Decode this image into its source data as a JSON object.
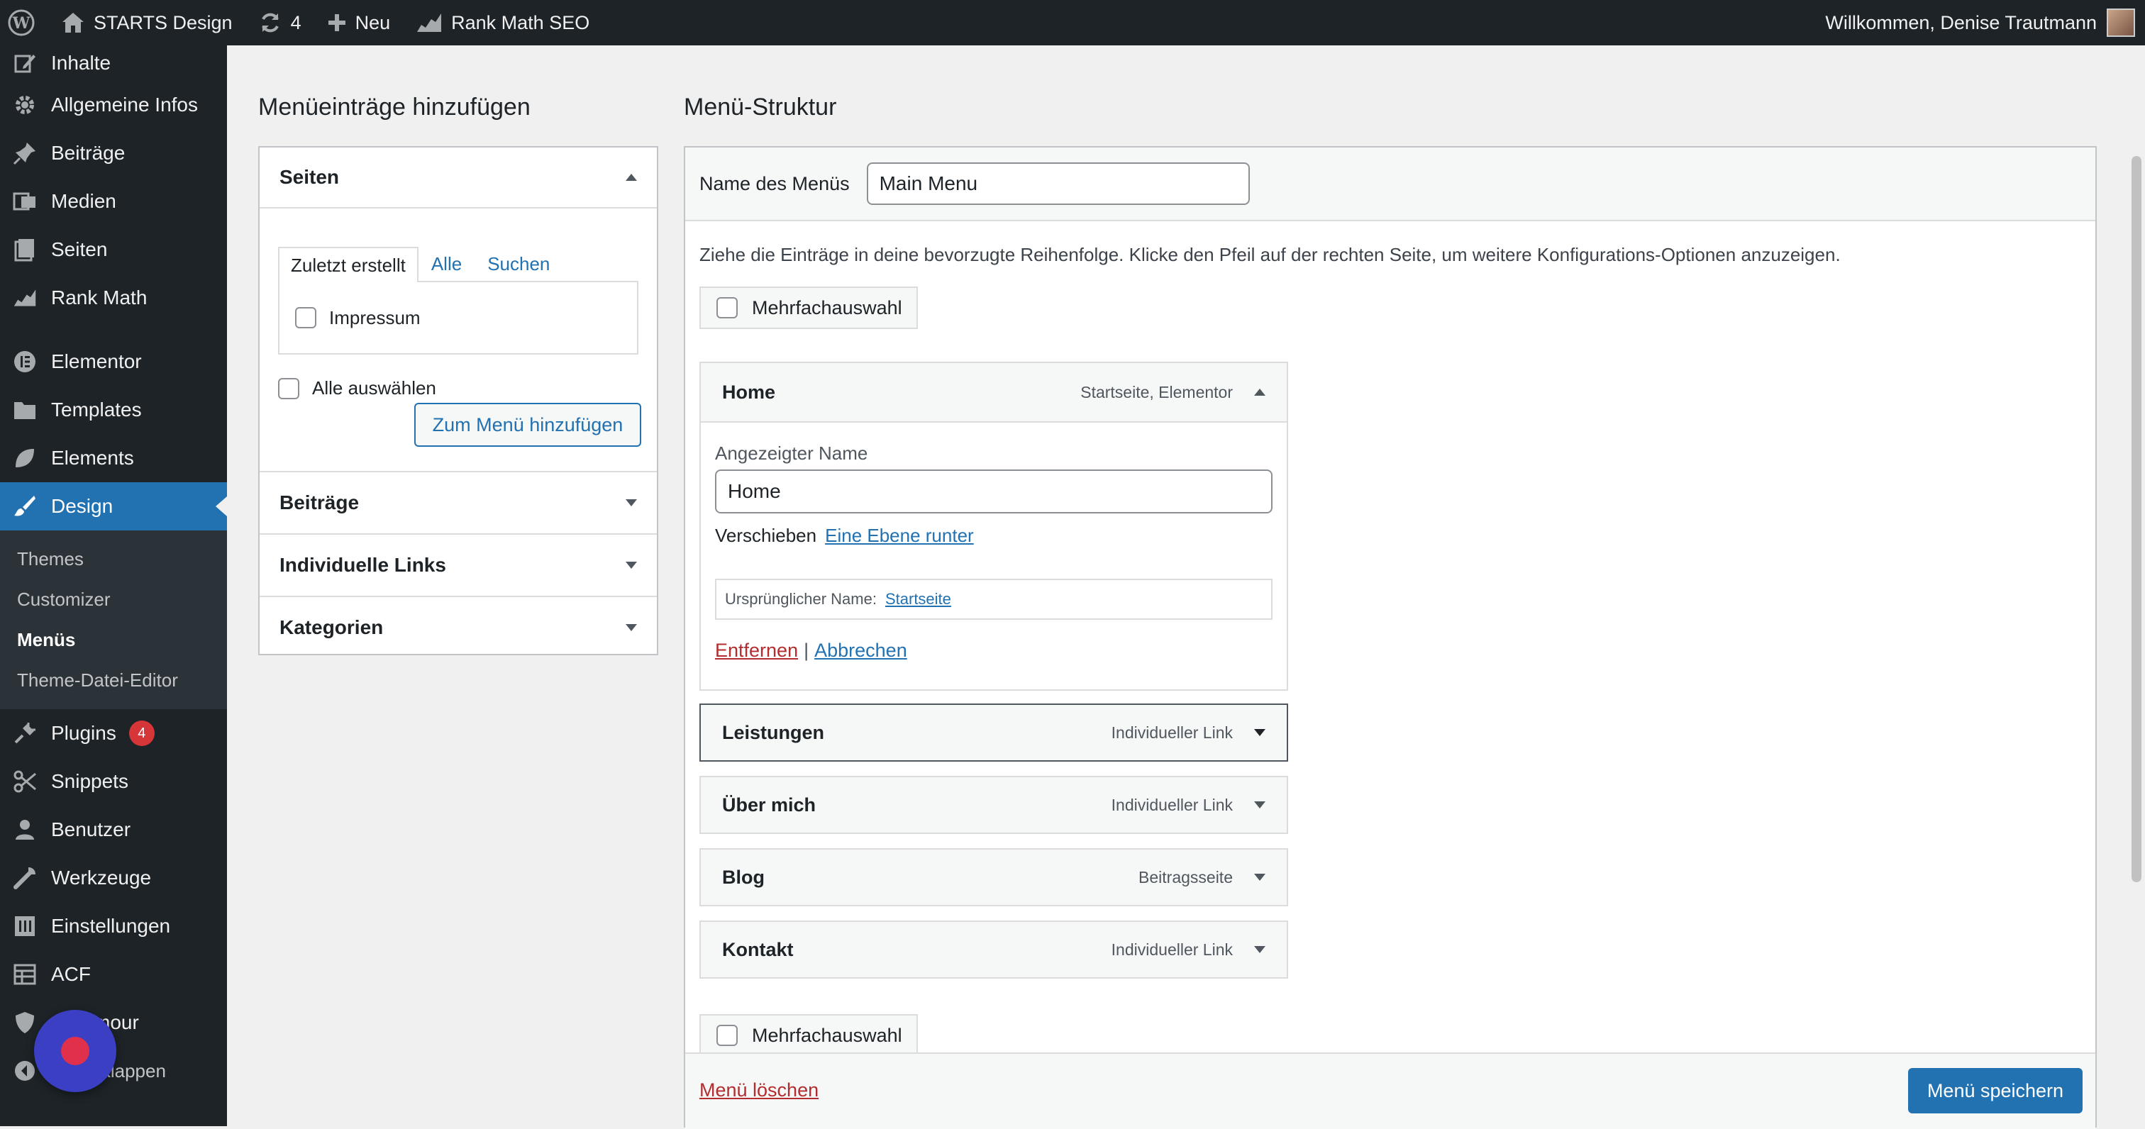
{
  "adminbar": {
    "site_name": "STARTS Design",
    "updates_count": "4",
    "new_label": "Neu",
    "rankmath_label": "Rank Math SEO",
    "greeting": "Willkommen, Denise Trautmann"
  },
  "sidebar": {
    "items": [
      {
        "label": "Inhalte"
      },
      {
        "label": "Allgemeine Infos"
      },
      {
        "label": "Beiträge"
      },
      {
        "label": "Medien"
      },
      {
        "label": "Seiten"
      },
      {
        "label": "Rank Math"
      },
      {
        "label": "Elementor"
      },
      {
        "label": "Templates"
      },
      {
        "label": "Elements"
      },
      {
        "label": "Design"
      }
    ],
    "design_submenu": [
      "Themes",
      "Customizer",
      "Menüs",
      "Theme-Datei-Editor"
    ],
    "items_after": [
      {
        "label": "Plugins",
        "badge": "4"
      },
      {
        "label": "Snippets"
      },
      {
        "label": "Benutzer"
      },
      {
        "label": "Werkzeuge"
      },
      {
        "label": "Einstellungen"
      },
      {
        "label": "ACF"
      },
      {
        "label": "mour"
      },
      {
        "label": "nü einklappen"
      }
    ]
  },
  "left_panel": {
    "heading": "Menüeinträge hinzufügen",
    "pages_section": {
      "title": "Seiten",
      "tabs": [
        "Zuletzt erstellt",
        "Alle",
        "Suchen"
      ],
      "items": [
        "Impressum"
      ],
      "select_all": "Alle auswählen",
      "add_button": "Zum Menü hinzufügen"
    },
    "other_sections": [
      "Beiträge",
      "Individuelle Links",
      "Kategorien"
    ]
  },
  "right_panel": {
    "heading": "Menü-Struktur",
    "menu_name_label": "Name des Menüs",
    "menu_name_value": "Main Menu",
    "instructions": "Ziehe die Einträge in deine bevorzugte Reihenfolge. Klicke den Pfeil auf der rechten Seite, um weitere Konfigurations-Optionen anzuzeigen.",
    "bulk_select": "Mehrfachauswahl",
    "expanded_item": {
      "title": "Home",
      "type": "Startseite, Elementor",
      "display_name_label": "Angezeigter Name",
      "display_name_value": "Home",
      "move_label": "Verschieben",
      "move_link": "Eine Ebene runter",
      "original_label": "Ursprünglicher Name:",
      "original_link": "Startseite",
      "remove": "Entfernen",
      "separator": "|",
      "cancel": "Abbrechen"
    },
    "items": [
      {
        "title": "Leistungen",
        "type": "Individueller Link"
      },
      {
        "title": "Über mich",
        "type": "Individueller Link"
      },
      {
        "title": "Blog",
        "type": "Beitragsseite"
      },
      {
        "title": "Kontakt",
        "type": "Individueller Link"
      }
    ],
    "delete_menu": "Menü löschen",
    "save_button": "Menü speichern"
  },
  "colors": {
    "admin_dark": "#1d2327",
    "accent": "#2271b1",
    "danger": "#b32d2e",
    "record": "#e0304b"
  }
}
